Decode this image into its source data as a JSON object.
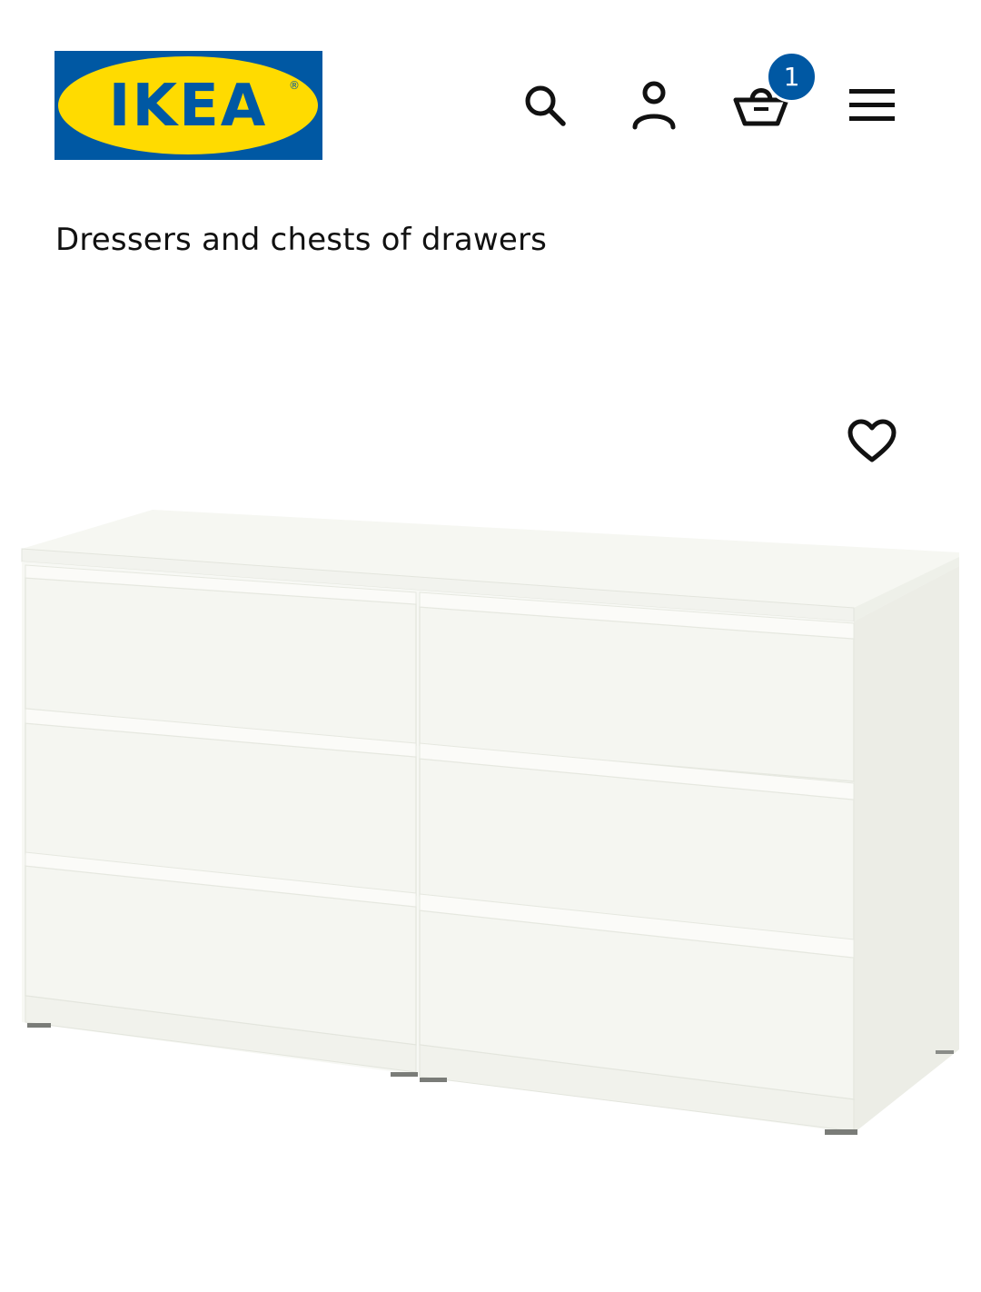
{
  "header": {
    "logo_text": "IKEA",
    "logo_registered": "®",
    "search_icon": "search-icon",
    "account_icon": "user-icon",
    "cart_icon": "basket-icon",
    "cart_count": "1",
    "menu_icon": "hamburger-menu-icon"
  },
  "category": {
    "title": "Dressers and chests of drawers"
  },
  "product": {
    "favorite_icon": "heart-icon",
    "image": "white-6-drawer-dresser-image"
  },
  "colors": {
    "brand_blue": "#0058a3",
    "brand_yellow": "#ffdb00",
    "text": "#111111"
  }
}
